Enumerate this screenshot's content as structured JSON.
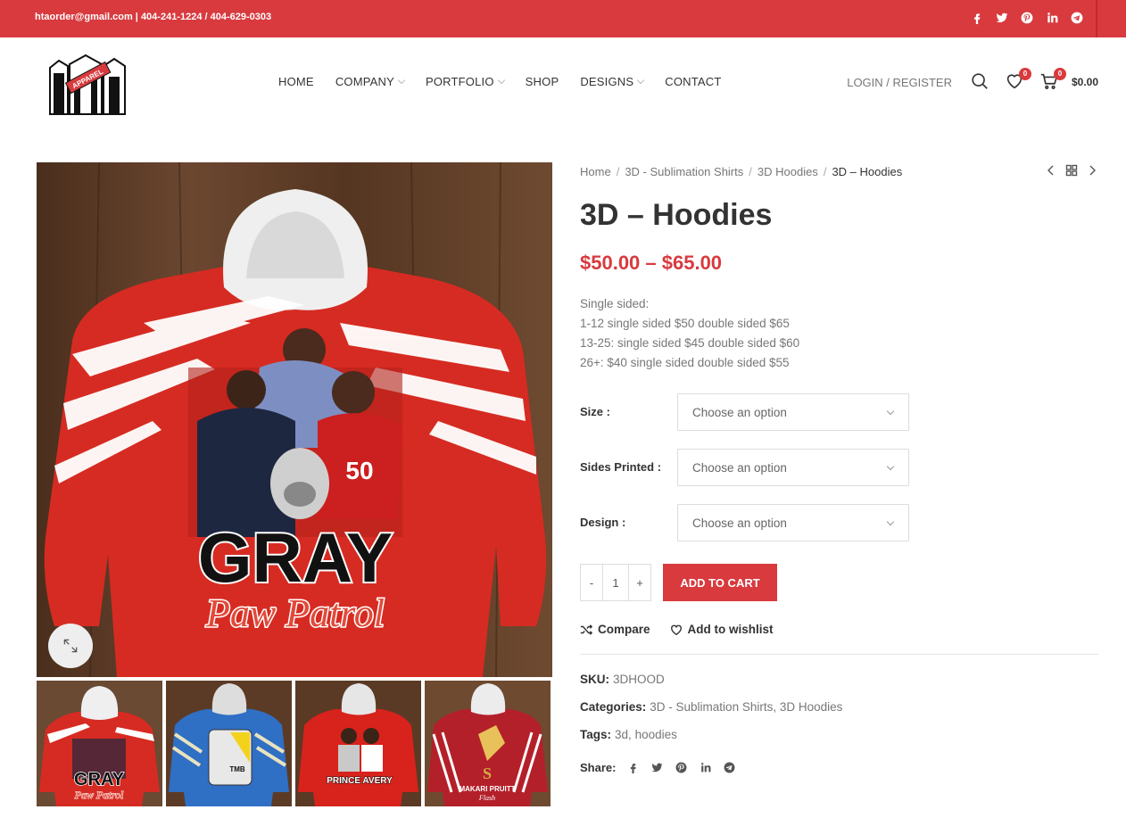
{
  "topbar": {
    "contact": "htaorder@gmail.com | 404-241-1224 / 404-629-0303",
    "socials": [
      "facebook-icon",
      "twitter-icon",
      "pinterest-icon",
      "linkedin-icon",
      "telegram-icon"
    ]
  },
  "logo": {
    "text": "APPAREL"
  },
  "nav": [
    {
      "label": "HOME",
      "dropdown": false
    },
    {
      "label": "COMPANY",
      "dropdown": true
    },
    {
      "label": "PORTFOLIO",
      "dropdown": true
    },
    {
      "label": "SHOP",
      "dropdown": false
    },
    {
      "label": "DESIGNS",
      "dropdown": true
    },
    {
      "label": "CONTACT",
      "dropdown": false
    }
  ],
  "header": {
    "login": "LOGIN / REGISTER",
    "wishlist_count": "0",
    "cart_count": "0",
    "cart_total": "$0.00"
  },
  "breadcrumb": [
    "Home",
    "3D - Sublimation Shirts",
    "3D Hoodies",
    "3D – Hoodies"
  ],
  "product": {
    "title": "3D – Hoodies",
    "price": "$50.00 – $65.00",
    "description": [
      "Single sided:",
      "1-12 single sided $50 double sided $65",
      "13-25: single sided $45 double sided $60",
      "26+: $40 single sided double sided $55"
    ],
    "variations": [
      {
        "label": "Size",
        "placeholder": "Choose an option"
      },
      {
        "label": "Sides Printed",
        "placeholder": "Choose an option"
      },
      {
        "label": "Design",
        "placeholder": "Choose an option"
      }
    ],
    "qty_minus": "-",
    "qty": "1",
    "qty_plus": "+",
    "add_to_cart": "ADD TO CART",
    "compare": "Compare",
    "wishlist": "Add to wishlist",
    "sku_label": "SKU:",
    "sku": "3DHOOD",
    "categories_label": "Categories:",
    "categories": [
      "3D - Sublimation Shirts",
      "3D Hoodies"
    ],
    "tags_label": "Tags:",
    "tags": [
      "3d",
      "hoodies"
    ],
    "share_label": "Share:"
  },
  "images": {
    "main_text_1": "GRAY",
    "main_text_2": "Paw Patrol",
    "thumbs": [
      {
        "caption": "GRAY",
        "caption2": "Paw Patrol"
      },
      {
        "caption": "TMB",
        "caption2": ""
      },
      {
        "caption": "PRINCE AVERY",
        "caption2": ""
      },
      {
        "caption": "MAKARI PRUITT",
        "caption2": "Flash"
      }
    ]
  },
  "colors": {
    "accent": "#d83a3e"
  }
}
